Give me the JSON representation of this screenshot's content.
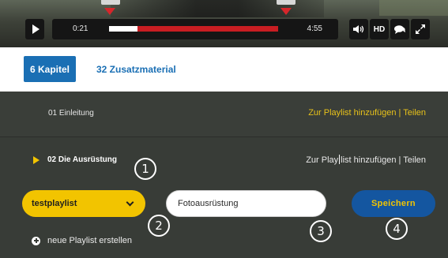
{
  "player": {
    "time_current": "0:21",
    "time_total": "4:55",
    "progress_played_fraction": 0.17,
    "hd_label": "HD",
    "icons": [
      "play-icon",
      "volume-icon",
      "hd-icon",
      "comments-icon",
      "fullscreen-icon"
    ],
    "colors": {
      "track": "#c81d22",
      "marker": "#d6262b",
      "bar": "#151515"
    }
  },
  "tabs": {
    "active_label": "6 Kapitel",
    "secondary_label": "32 Zusatzmaterial"
  },
  "chapters": [
    {
      "title": "01 Einleitung",
      "actions": "Zur Playlist hinzufügen | Teilen"
    },
    {
      "title": "02 Die Ausrüstung",
      "actions_before_cursor": "Zur Play",
      "actions_after_cursor": "list hinzufügen | Teilen"
    }
  ],
  "playlist_form": {
    "selected_playlist": "testplaylist",
    "name_value": "Fotoausrüstung",
    "save_label": "Speichern",
    "new_playlist_label": "neue Playlist erstellen"
  },
  "callouts": [
    "1",
    "2",
    "3",
    "4"
  ],
  "colors": {
    "accent_yellow": "#f2c400",
    "brand_blue": "#1a6fb4",
    "save_blue": "#1456a0",
    "panel_bg": "#383c37"
  }
}
